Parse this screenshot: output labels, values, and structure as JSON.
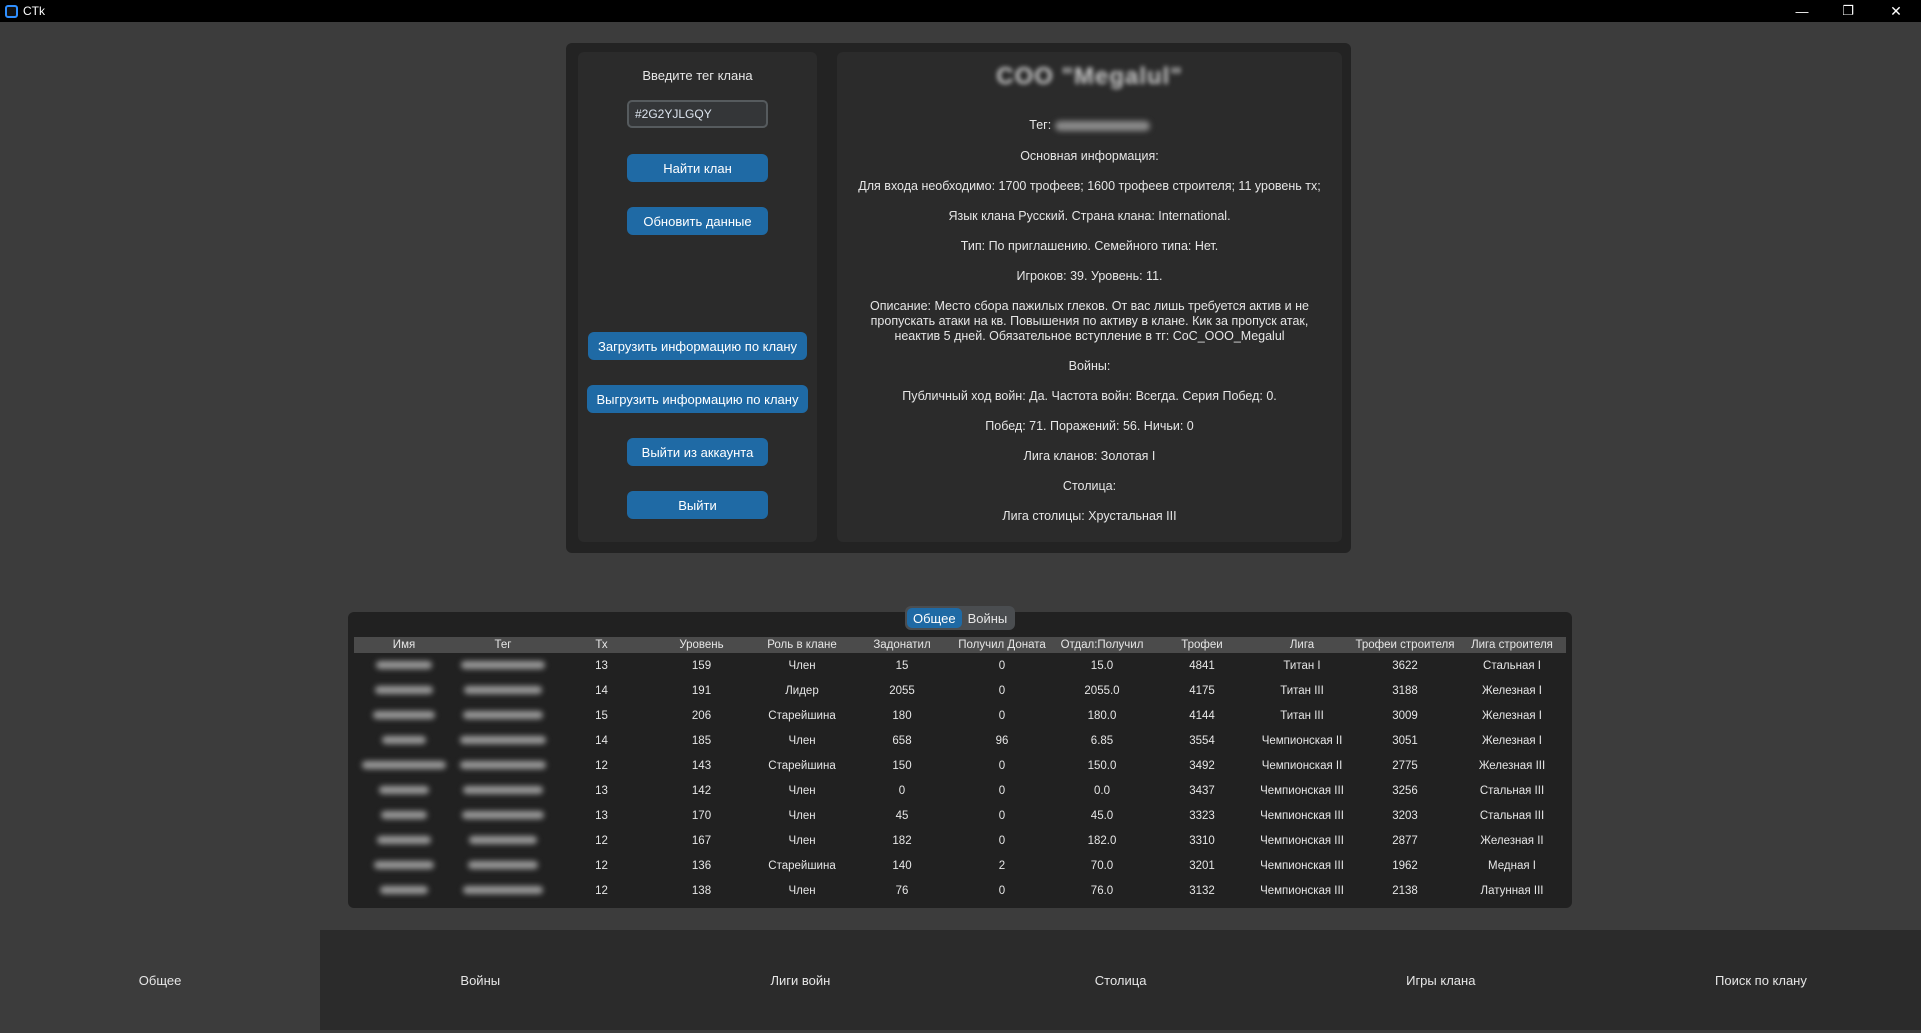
{
  "window": {
    "title": "CTk",
    "minimize_glyph": "—",
    "maximize_glyph": "❐",
    "close_glyph": "✕"
  },
  "left_panel": {
    "prompt": "Введите тег клана",
    "tag_value": "#2G2YJLGQY",
    "buttons": {
      "find": "Найти клан",
      "refresh": "Обновить данные",
      "load": "Загрузить информацию по клану",
      "export": "Выгрузить информацию по клану",
      "logout": "Выйти из аккаунта",
      "exit": "Выйти"
    }
  },
  "clan_info": {
    "name": "COO \"Megalul\"",
    "tag_label": "Тег:",
    "main_header": "Основная информация:",
    "entry_requirements": "Для входа необходимо: 1700 трофеев; 1600 трофеев строителя; 11 уровень тх;",
    "language_country": "Язык клана Русский. Страна клана: International.",
    "type_line": "Тип: По приглашению. Семейного типа: Нет.",
    "players_level": "Игроков: 39. Уровень: 11.",
    "description_1": "Описание: Место сбора пажилых глеков. От вас лишь требуется актив и не",
    "description_2": "пропускать атаки на кв. Повышения по активу в клане. Кик за пропуск атак,",
    "description_3": "неактив 5 дней. Обязательное вступление в тг: CoC_OOO_Megalul",
    "wars_header": "Войны:",
    "war_settings": "Публичный ход войн: Да. Частота войн: Всегда. Серия Побед: 0.",
    "war_record": "Побед: 71. Поражений: 56. Ничьи: 0",
    "war_league": "Лига кланов: Золотая I",
    "capital_header": "Столица:",
    "capital_league": "Лига столицы: Хрустальная III"
  },
  "table_tabs": [
    "Общее",
    "Войны"
  ],
  "table": {
    "columns": [
      "Имя",
      "Тег",
      "Тх",
      "Уровень",
      "Роль в клане",
      "Задонатил",
      "Получил Доната",
      "Отдал:Получил",
      "Трофеи",
      "Лига",
      "Трофеи строителя",
      "Лига строителя"
    ],
    "rows": [
      [
        "13",
        "159",
        "Член",
        "15",
        "0",
        "15.0",
        "4841",
        "Титан I",
        "3622",
        "Стальная I"
      ],
      [
        "14",
        "191",
        "Лидер",
        "2055",
        "0",
        "2055.0",
        "4175",
        "Титан III",
        "3188",
        "Железная I"
      ],
      [
        "15",
        "206",
        "Старейшина",
        "180",
        "0",
        "180.0",
        "4144",
        "Титан III",
        "3009",
        "Железная I"
      ],
      [
        "14",
        "185",
        "Член",
        "658",
        "96",
        "6.85",
        "3554",
        "Чемпионская II",
        "3051",
        "Железная I"
      ],
      [
        "12",
        "143",
        "Старейшина",
        "150",
        "0",
        "150.0",
        "3492",
        "Чемпионская II",
        "2775",
        "Железная III"
      ],
      [
        "13",
        "142",
        "Член",
        "0",
        "0",
        "0.0",
        "3437",
        "Чемпионская III",
        "3256",
        "Стальная III"
      ],
      [
        "13",
        "170",
        "Член",
        "45",
        "0",
        "45.0",
        "3323",
        "Чемпионская III",
        "3203",
        "Стальная III"
      ],
      [
        "12",
        "167",
        "Член",
        "182",
        "0",
        "182.0",
        "3310",
        "Чемпионская III",
        "2877",
        "Железная II"
      ],
      [
        "12",
        "136",
        "Старейшина",
        "140",
        "2",
        "70.0",
        "3201",
        "Чемпионская III",
        "1962",
        "Медная I"
      ],
      [
        "12",
        "138",
        "Член",
        "76",
        "0",
        "76.0",
        "3132",
        "Чемпионская III",
        "2138",
        "Латунная III"
      ]
    ]
  },
  "bottom_nav": [
    "Общее",
    "Войны",
    "Лиги войн",
    "Столица",
    "Игры клана",
    "Поиск по клану"
  ],
  "colors": {
    "accent": "#1f6aa5",
    "background": "#3c3c3c",
    "panel": "#2b2b2b"
  }
}
